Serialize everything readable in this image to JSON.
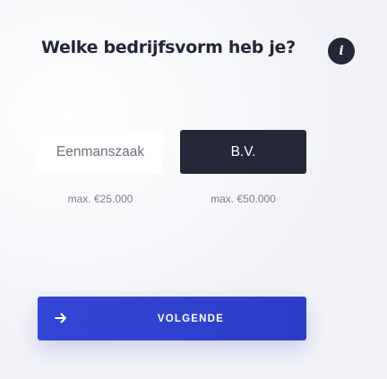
{
  "question": {
    "title": "Welke bedrijfsvorm heb je?",
    "info_icon": "info-icon",
    "info_glyph": "i"
  },
  "options": [
    {
      "label": "Eenmanszaak",
      "limit": "max. €25.000",
      "selected": false
    },
    {
      "label": "B.V.",
      "limit": "max. €50.000",
      "selected": true
    }
  ],
  "next_button": {
    "label": "VOLGENDE",
    "icon": "arrow-right-icon"
  },
  "colors": {
    "dark": "#232737",
    "accent": "#3346d6",
    "muted_text": "#7c7f8b"
  }
}
